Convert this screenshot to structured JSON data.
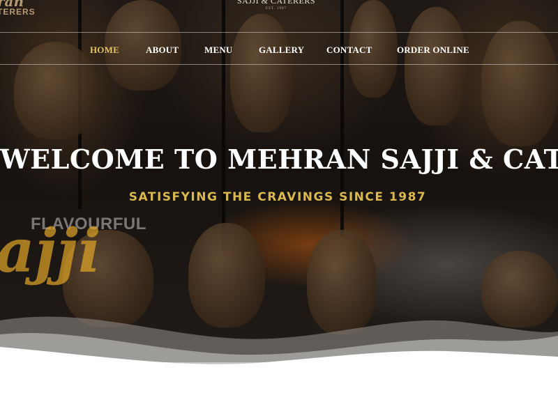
{
  "header": {
    "logo_script": "ran",
    "logo_sub": "TERERS",
    "logo_reg": "®",
    "brand_name": "SAJJI & CATERERS",
    "brand_est": "EST. 1987"
  },
  "nav": {
    "items": [
      {
        "label": "HOME",
        "active": true
      },
      {
        "label": "ABOUT",
        "active": false
      },
      {
        "label": "MENU",
        "active": false
      },
      {
        "label": "GALLERY",
        "active": false
      },
      {
        "label": "CONTACT",
        "active": false
      },
      {
        "label": "ORDER ONLINE",
        "active": false
      }
    ]
  },
  "hero": {
    "headline": "WELCOME TO MEHRAN SAJJI & CATERERS",
    "tagline": "SATISFYING THE CRAVINGS SINCE 1987",
    "promo_top": "FLAVOURFUL",
    "promo_script": "ajji"
  },
  "colors": {
    "accent_gold": "#e3c36a",
    "tagline_gold": "#d9b94e",
    "nav_text": "#ffffff"
  }
}
